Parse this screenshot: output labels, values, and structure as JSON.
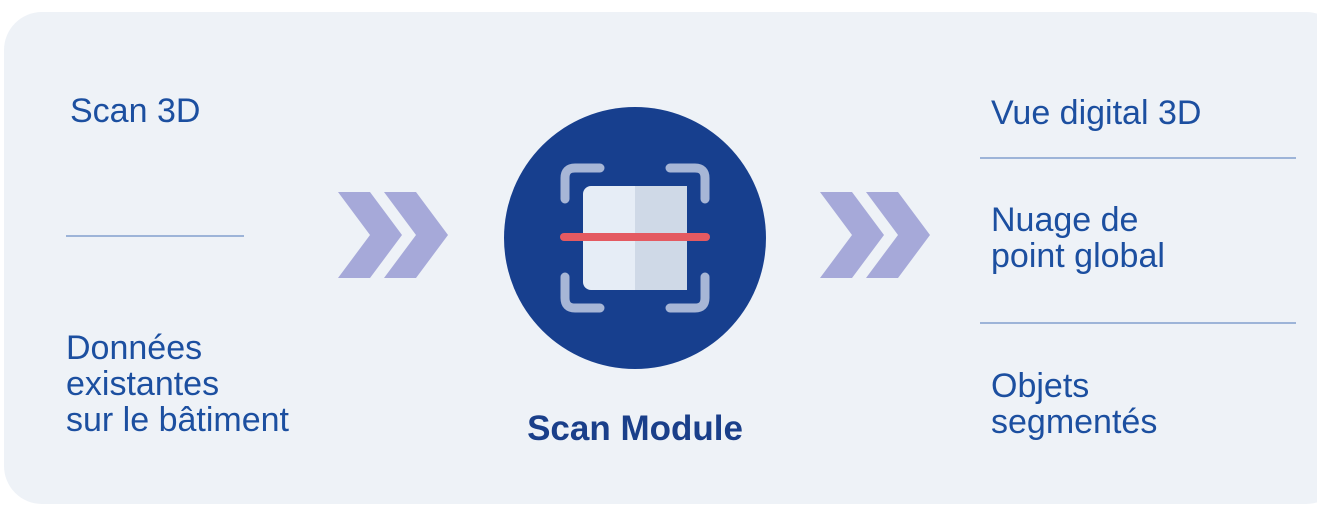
{
  "left": {
    "top_label": "Scan 3D",
    "bottom_label": "Données\nexistantes\nsur le bâtiment"
  },
  "center": {
    "icon": "scan-icon",
    "label": "Scan Module"
  },
  "right": {
    "items": [
      "Vue digital 3D",
      "Nuage de\npoint global",
      "Objets\nsegmentés"
    ]
  },
  "colors": {
    "background": "#eef2f7",
    "text": "#1c4fa0",
    "circle": "#173f8e",
    "chevron": "#a6a9d9",
    "scan_line": "#e45a61",
    "divider": "#9db4d8"
  }
}
